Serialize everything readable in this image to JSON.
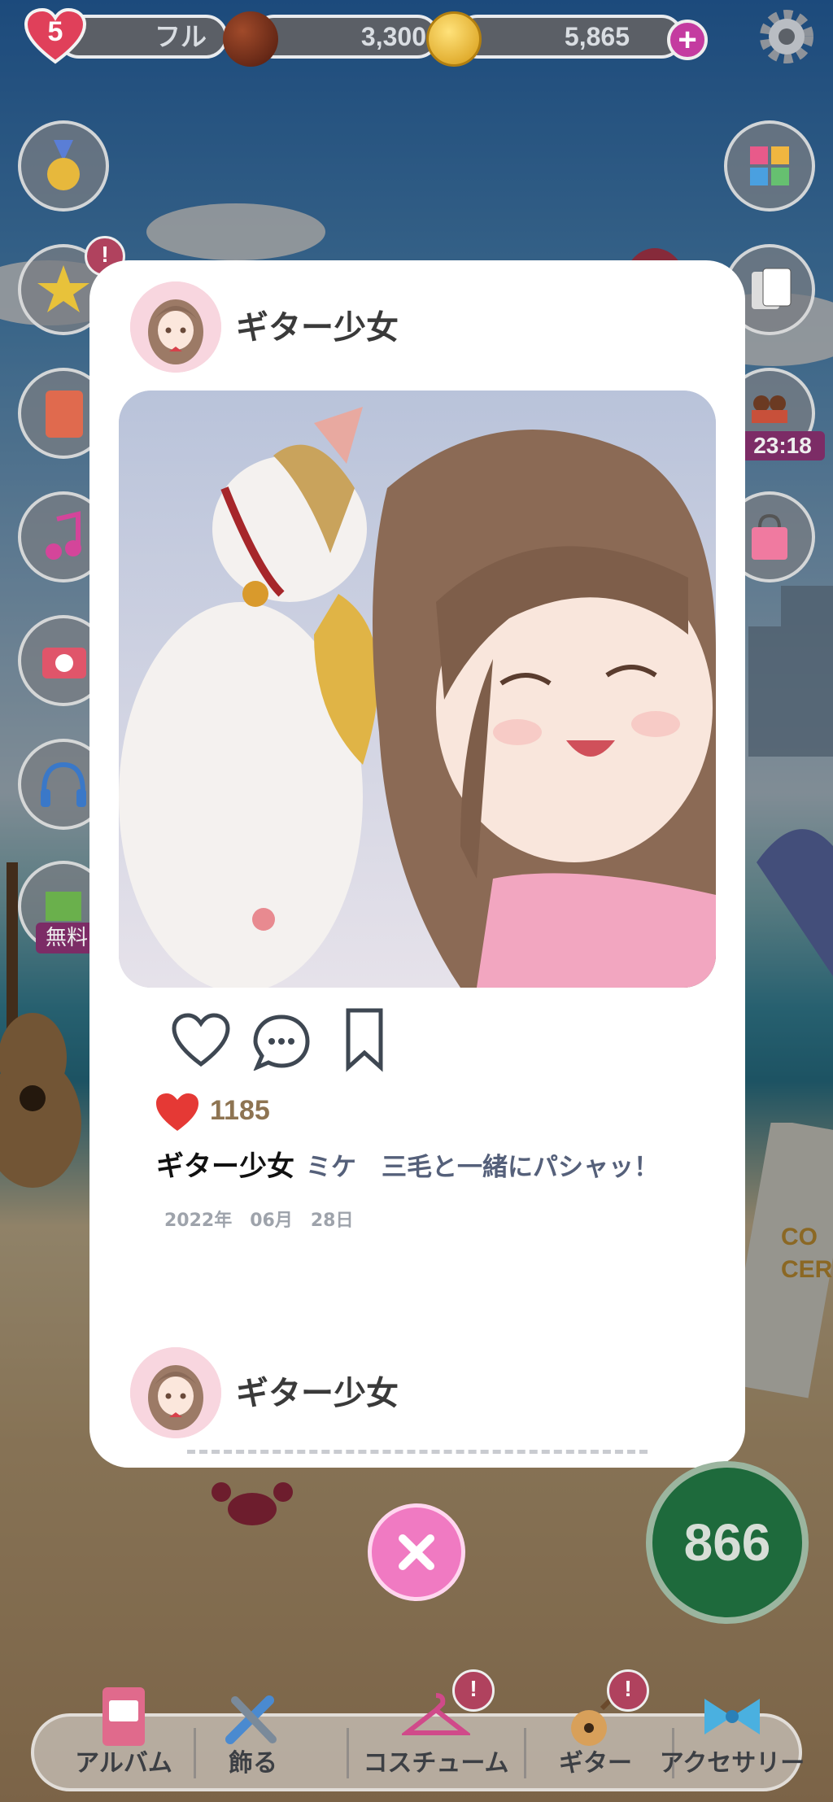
{
  "status_bar": {
    "hearts_count": "5",
    "hearts_status": "フル",
    "chocolate_count": "3,300",
    "coin_count": "5,865",
    "add_label": "+"
  },
  "side_badges": {
    "alert": "!",
    "timer": "23:18",
    "free_label": "無料"
  },
  "post": {
    "username": "ギター少女",
    "like_count": "1185",
    "caption_user": "ギター少女",
    "caption_text": "ミケ　三毛と一緒にパシャッ！",
    "date": "2022年　06月　28日"
  },
  "next_post": {
    "username": "ギター少女"
  },
  "close_label": "✕",
  "count_display": "866",
  "bottom_nav": {
    "items": [
      {
        "label": "アルバム"
      },
      {
        "label": "飾る"
      },
      {
        "label": "コスチューム",
        "badge": "!"
      },
      {
        "label": "ギター",
        "badge": "!"
      },
      {
        "label": "アクセサリー"
      }
    ]
  },
  "colors": {
    "card": "#ffffff",
    "like_heart": "#e53935",
    "close_button": "#f07ac2",
    "count_circle": "#1e6a3c"
  }
}
